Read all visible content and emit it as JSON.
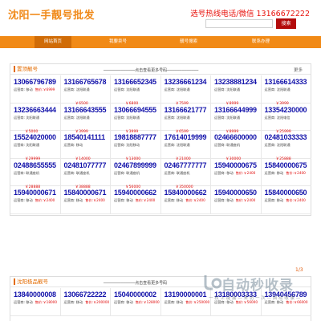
{
  "header": {
    "logo": "沈阳一手靓号批发",
    "hotline": "选号热线电话/微信 13166672222",
    "search_placeholder": "",
    "search_button": "搜索"
  },
  "nav": {
    "items": [
      "网站首页",
      "我要卖号",
      "靓号搜索",
      "联系办理"
    ]
  },
  "panel1": {
    "title": "置顶靓号",
    "middle": "─────────────点击查看更多号码─────────────",
    "more": "更多",
    "rows": [
      [
        {
          "num": "13066796789",
          "carrier": "运营商: 移动",
          "price": "售价:￥6999"
        },
        {
          "num": "13166765678",
          "carrier": "运营商: 沈阳联通",
          "price": "￥6500"
        },
        {
          "num": "13166652345",
          "carrier": "运营商: 沈阳联通",
          "price": "￥6800"
        },
        {
          "num": "13236661234",
          "carrier": "运营商: 沈阳联通",
          "price": "￥7599"
        },
        {
          "num": "13238881234",
          "carrier": "运营商: 沈阳联通",
          "price": "￥8999"
        },
        {
          "num": "13166614333",
          "carrier": "运营商: 沈阳联通",
          "price": "￥3999"
        }
      ],
      [
        {
          "num": "13236663444",
          "carrier": "运营商: 沈阳联通",
          "price": "￥5000"
        },
        {
          "num": "13166643555",
          "carrier": "运营商: 沈阳联通",
          "price": "￥3999"
        },
        {
          "num": "13066694555",
          "carrier": "运营商: 沈阳联通",
          "price": "￥3999"
        },
        {
          "num": "13166621777",
          "carrier": "运营商: 沈阳联通",
          "price": "￥6599"
        },
        {
          "num": "13166644999",
          "carrier": "运营商: 沈阳联通",
          "price": "￥8999"
        },
        {
          "num": "13354230000",
          "carrier": "运营商: 沈阳电信",
          "price": "￥25999"
        }
      ],
      [
        {
          "num": "15524020000",
          "carrier": "运营商: 沈阳联通",
          "price": "￥29999"
        },
        {
          "num": "18540141111",
          "carrier": "运营商: 移动",
          "price": "￥14000"
        },
        {
          "num": "19818887777",
          "carrier": "运营商: 沈阳移动",
          "price": "￥13000"
        },
        {
          "num": "17614019999",
          "carrier": "运营商: 沈阳联通",
          "price": "￥21000"
        },
        {
          "num": "02466600000",
          "carrier": "运营商: 联通座机",
          "price": "￥30000"
        },
        {
          "num": "02481033333",
          "carrier": "运营商: 沈阳联通",
          "price": "￥25888"
        }
      ],
      [
        {
          "num": "02488655555",
          "carrier": "运营商: 联通座机",
          "price": "￥28888"
        },
        {
          "num": "02481077777",
          "carrier": "运营商: 联通座机",
          "price": "￥38888"
        },
        {
          "num": "02467899999",
          "carrier": "运营商: 联通座机",
          "price": "￥56000"
        },
        {
          "num": "02467777777",
          "carrier": "运营商: 联通座机",
          "price": "￥350000"
        },
        {
          "num": "15940000675",
          "carrier": "运营商: 移动",
          "price": "售价:￥2400"
        },
        {
          "num": "15840000675",
          "carrier": "运营商: 移动",
          "price": "售价:￥2400"
        }
      ],
      [
        {
          "num": "15940000671",
          "carrier": "运营商: 移动",
          "price": "售价:￥2400"
        },
        {
          "num": "15840000671",
          "carrier": "运营商: 移动",
          "price": "售价:￥2400"
        },
        {
          "num": "15940000662",
          "carrier": "运营商: 移动",
          "price": "售价:￥2400"
        },
        {
          "num": "15840000662",
          "carrier": "运营商: 移动",
          "price": "售价:￥2400"
        },
        {
          "num": "15940000650",
          "carrier": "运营商: 移动",
          "price": "售价:￥2400"
        },
        {
          "num": "15840000650",
          "carrier": "运营商: 移动",
          "price": "售价:￥2400"
        }
      ]
    ]
  },
  "panel2": {
    "title": "沈阳极品靓号",
    "middle": "─────────────点击查看更多号码",
    "page": "1/3",
    "rows": [
      [
        {
          "num": "13840000008",
          "carrier": "运营商: 移动",
          "price": "售价:￥18000"
        },
        {
          "num": "13066722222",
          "carrier": "运营商: 移动",
          "price": "售价:￥200000"
        },
        {
          "num": "15040000002",
          "carrier": "运营商: 移动",
          "price": "售价:￥128000"
        },
        {
          "num": "13190000001",
          "carrier": "运营商: 移动",
          "price": "售价:￥250000"
        },
        {
          "num": "13180003333",
          "carrier": "运营商: 移动",
          "price": "售价:￥56000"
        },
        {
          "num": "13940456789",
          "carrier": "运营商: 移动",
          "price": "售价:￥66000"
        }
      ]
    ]
  },
  "watermark": {
    "main": "自动秒收录",
    "sub": "一 枚 上 链 接 — 来 访 一 次 — 自 动 收 录 —"
  }
}
